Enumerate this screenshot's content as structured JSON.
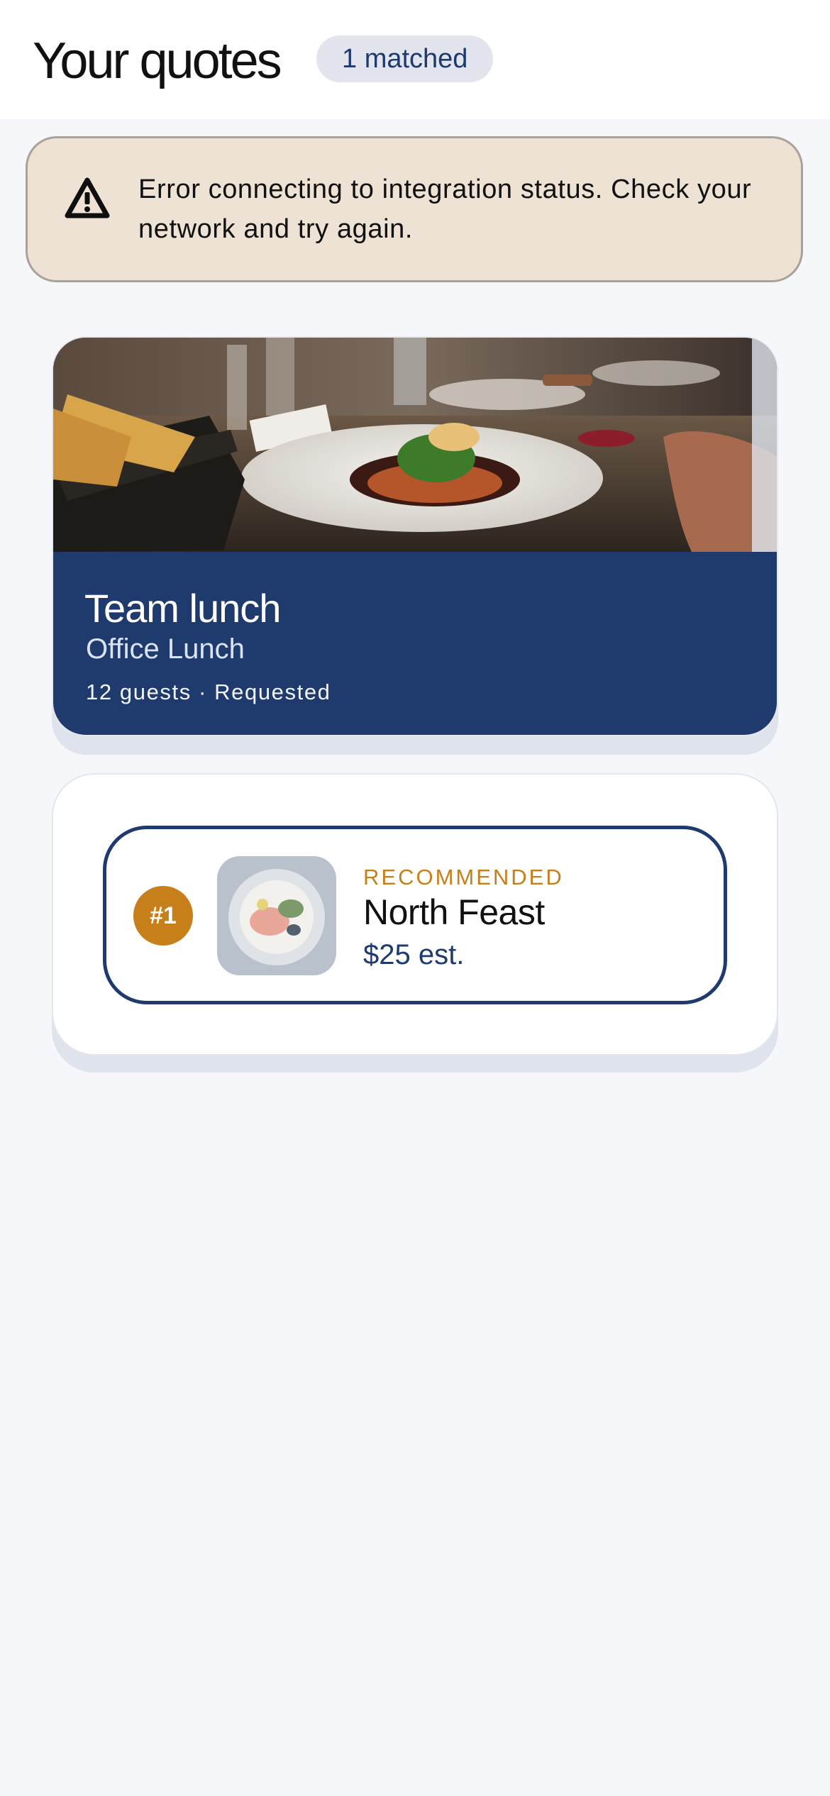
{
  "header": {
    "title": "Your quotes",
    "matched_badge": "1 matched"
  },
  "alert": {
    "icon": "warning-triangle-icon",
    "message": "Error connecting to integration status. Check your network and try again."
  },
  "event": {
    "title": "Team lunch",
    "subtitle": "Office Lunch",
    "meta": "12 guests · Requested",
    "colors": {
      "card_bg": "#1f3b6e"
    }
  },
  "quotes": [
    {
      "rank": "#1",
      "tag": "RECOMMENDED",
      "name": "North Feast",
      "price": "$25 est.",
      "colors": {
        "accent": "#c77f1a",
        "border": "#1e3a6e"
      }
    }
  ]
}
